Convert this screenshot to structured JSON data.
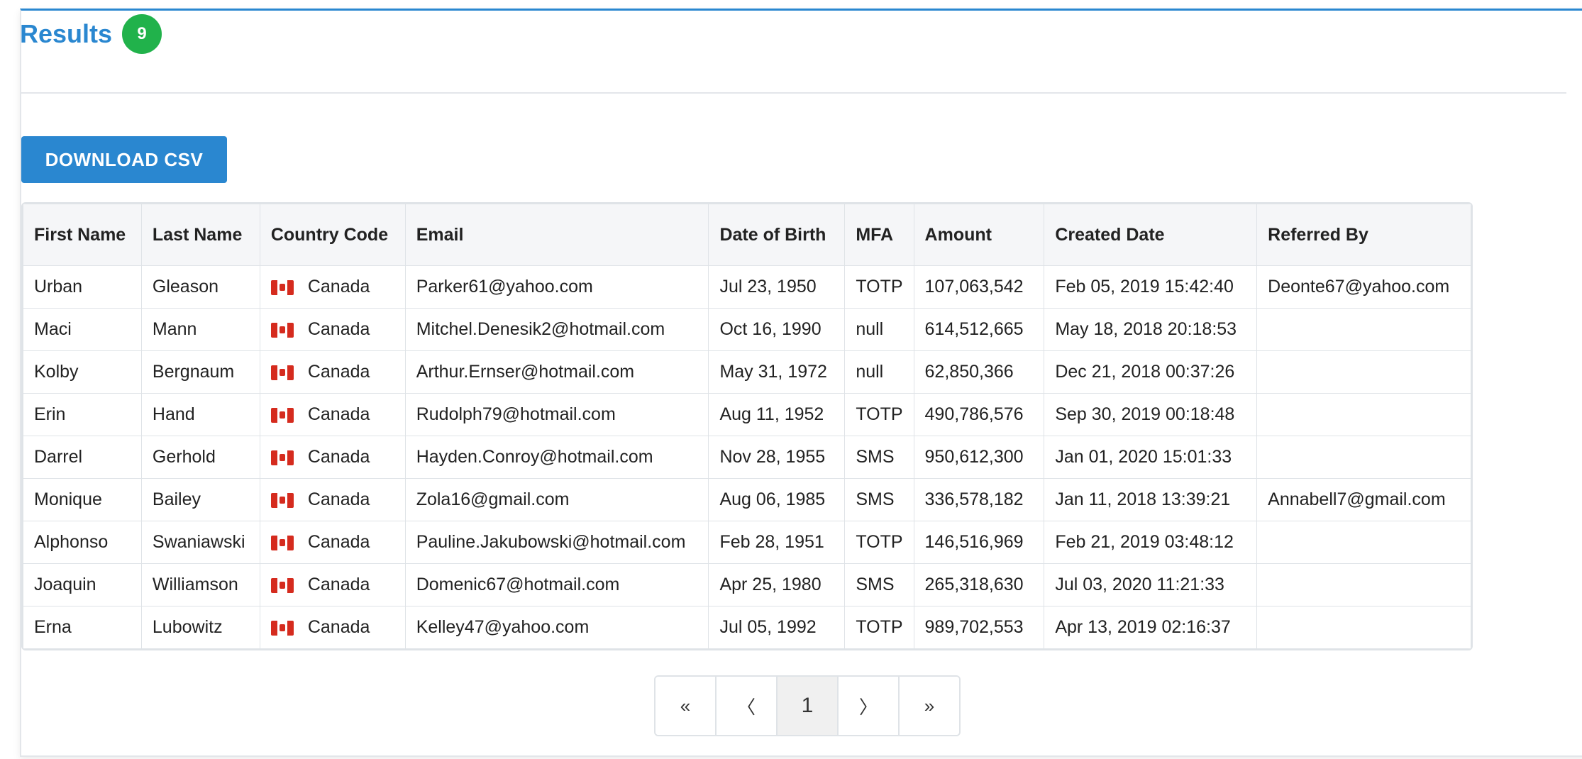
{
  "results": {
    "title": "Results",
    "count": "9"
  },
  "toolbar": {
    "download_label": "DOWNLOAD CSV"
  },
  "table": {
    "columns": [
      "First Name",
      "Last Name",
      "Country Code",
      "Email",
      "Date of Birth",
      "MFA",
      "Amount",
      "Created Date",
      "Referred By"
    ],
    "rows": [
      [
        "Urban",
        "Gleason",
        "Canada",
        "Parker61@yahoo.com",
        "Jul 23, 1950",
        "TOTP",
        "107,063,542",
        "Feb 05, 2019 15:42:40",
        "Deonte67@yahoo.com"
      ],
      [
        "Maci",
        "Mann",
        "Canada",
        "Mitchel.Denesik2@hotmail.com",
        "Oct 16, 1990",
        "null",
        "614,512,665",
        "May 18, 2018 20:18:53",
        ""
      ],
      [
        "Kolby",
        "Bergnaum",
        "Canada",
        "Arthur.Ernser@hotmail.com",
        "May 31, 1972",
        "null",
        "62,850,366",
        "Dec 21, 2018 00:37:26",
        ""
      ],
      [
        "Erin",
        "Hand",
        "Canada",
        "Rudolph79@hotmail.com",
        "Aug 11, 1952",
        "TOTP",
        "490,786,576",
        "Sep 30, 2019 00:18:48",
        ""
      ],
      [
        "Darrel",
        "Gerhold",
        "Canada",
        "Hayden.Conroy@hotmail.com",
        "Nov 28, 1955",
        "SMS",
        "950,612,300",
        "Jan 01, 2020 15:01:33",
        ""
      ],
      [
        "Monique",
        "Bailey",
        "Canada",
        "Zola16@gmail.com",
        "Aug 06, 1985",
        "SMS",
        "336,578,182",
        "Jan 11, 2018 13:39:21",
        "Annabell7@gmail.com"
      ],
      [
        "Alphonso",
        "Swaniawski",
        "Canada",
        "Pauline.Jakubowski@hotmail.com",
        "Feb 28, 1951",
        "TOTP",
        "146,516,969",
        "Feb 21, 2019 03:48:12",
        ""
      ],
      [
        "Joaquin",
        "Williamson",
        "Canada",
        "Domenic67@hotmail.com",
        "Apr 25, 1980",
        "SMS",
        "265,318,630",
        "Jul 03, 2020 11:21:33",
        ""
      ],
      [
        "Erna",
        "Lubowitz",
        "Canada",
        "Kelley47@yahoo.com",
        "Jul 05, 1992",
        "TOTP",
        "989,702,553",
        "Apr 13, 2019 02:16:37",
        ""
      ]
    ]
  },
  "pagination": {
    "first": "«",
    "prev": "〈",
    "current": "1",
    "next": "〉",
    "last": "»"
  },
  "colors": {
    "accent": "#2a87d0",
    "badge": "#21b24b"
  },
  "icons": {
    "country_flag": "canada-flag-icon"
  }
}
